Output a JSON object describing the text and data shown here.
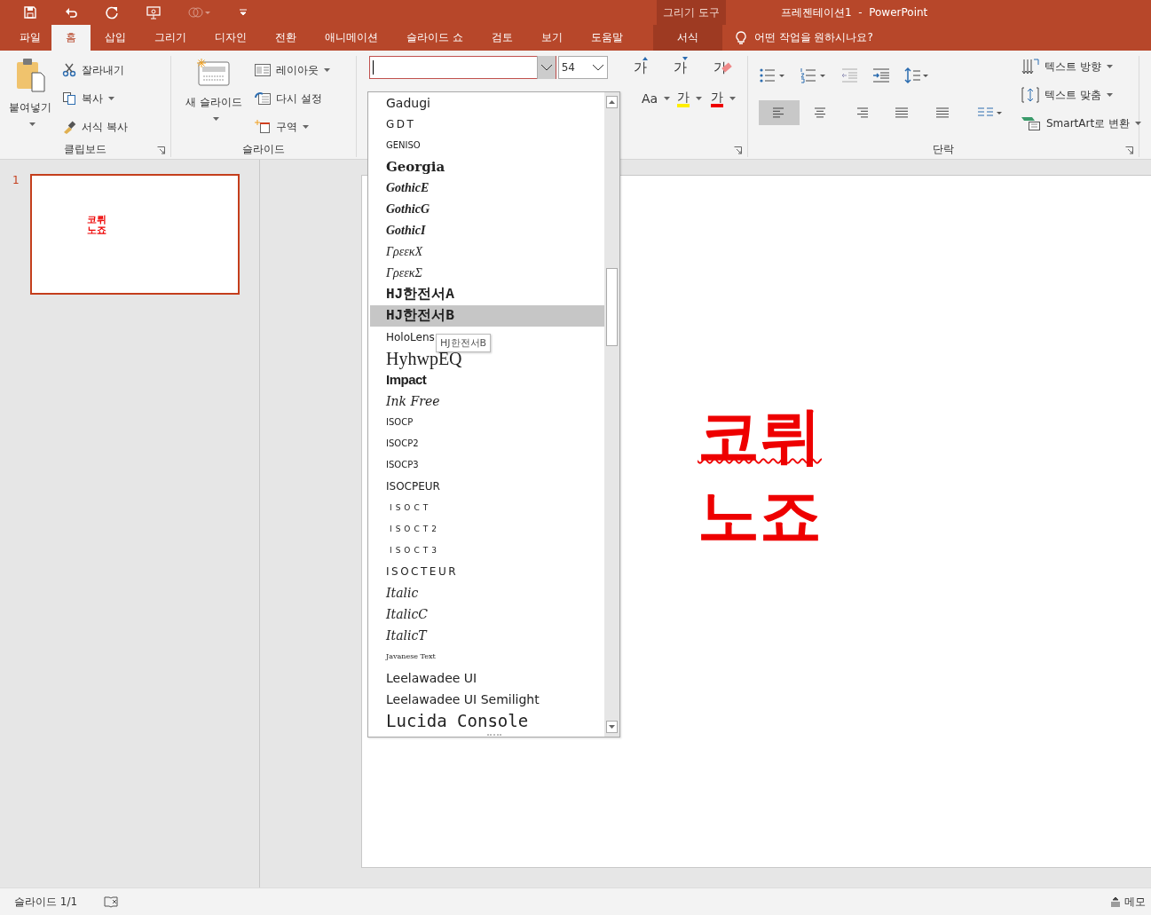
{
  "title_bar": {
    "context_group": "그리기 도구",
    "title": "프레젠테이션1  -  PowerPoint"
  },
  "tabs": [
    {
      "label": "파일",
      "selected": false,
      "kind": "file"
    },
    {
      "label": "홈",
      "selected": true,
      "kind": "normal"
    },
    {
      "label": "삽입",
      "selected": false,
      "kind": "normal"
    },
    {
      "label": "그리기",
      "selected": false,
      "kind": "normal"
    },
    {
      "label": "디자인",
      "selected": false,
      "kind": "normal"
    },
    {
      "label": "전환",
      "selected": false,
      "kind": "normal"
    },
    {
      "label": "애니메이션",
      "selected": false,
      "kind": "normal"
    },
    {
      "label": "슬라이드 쇼",
      "selected": false,
      "kind": "normal"
    },
    {
      "label": "검토",
      "selected": false,
      "kind": "normal"
    },
    {
      "label": "보기",
      "selected": false,
      "kind": "normal"
    },
    {
      "label": "도움말",
      "selected": false,
      "kind": "normal"
    },
    {
      "label": "서식",
      "selected": false,
      "kind": "context"
    }
  ],
  "tell_me": "어떤 작업을 원하시나요?",
  "clipboard": {
    "paste": "붙여넣기",
    "cut": "잘라내기",
    "copy": "복사",
    "format_painter": "서식 복사",
    "label": "클립보드"
  },
  "slides_group": {
    "new_slide": "새 슬라이드",
    "layout": "레이아웃",
    "reset": "다시 설정",
    "section": "구역",
    "label": "슬라이드"
  },
  "font_group": {
    "size": "54",
    "grow": "가",
    "shrink": "가",
    "clear": "가",
    "change_case": "Aa",
    "highlight": "가",
    "font_color": "가"
  },
  "paragraph": {
    "label": "단락",
    "text_direction": "텍스트 방향",
    "align_text": "텍스트 맞춤",
    "smartart": "SmartArt로 변환",
    "alignment": [
      {
        "kind": "left",
        "selected": true
      },
      {
        "kind": "center",
        "selected": false
      },
      {
        "kind": "right",
        "selected": false
      },
      {
        "kind": "justify",
        "selected": false
      },
      {
        "kind": "distributed",
        "selected": false
      }
    ]
  },
  "font_list": {
    "items": [
      {
        "label": "Gadugi",
        "kind": "plain",
        "selected": false
      },
      {
        "label": "GDT",
        "kind": "spaced",
        "selected": false
      },
      {
        "label": "GENISO",
        "kind": "small",
        "selected": false
      },
      {
        "label": "Georgia",
        "kind": "serif-bold",
        "selected": false
      },
      {
        "label": "GothicE",
        "kind": "blackletter",
        "selected": false
      },
      {
        "label": "GothicG",
        "kind": "blackletter",
        "selected": false
      },
      {
        "label": "GothicI",
        "kind": "blackletter",
        "selected": false
      },
      {
        "label": "ΓρεεκΧ",
        "kind": "greek",
        "selected": false
      },
      {
        "label": "ΓρεεκΣ",
        "kind": "greek",
        "selected": false
      },
      {
        "label": "HJ한전서A",
        "kind": "seal",
        "selected": false
      },
      {
        "label": "HJ한전서B",
        "kind": "seal",
        "selected": true
      },
      {
        "label": "HoloLens",
        "kind": "small-plain",
        "selected": false
      },
      {
        "label": "HyhwpEQ",
        "kind": "serif-large",
        "selected": false
      },
      {
        "label": "Impact",
        "kind": "impact",
        "selected": false
      },
      {
        "label": "Ink Free",
        "kind": "script",
        "selected": false
      },
      {
        "label": "ISOCP",
        "kind": "small",
        "selected": false
      },
      {
        "label": "ISOCP2",
        "kind": "small",
        "selected": false
      },
      {
        "label": "ISOCP3",
        "kind": "small",
        "selected": false
      },
      {
        "label": "ISOCPEUR",
        "kind": "medium",
        "selected": false
      },
      {
        "label": "ISOCT",
        "kind": "spaced-small",
        "selected": false
      },
      {
        "label": "ISOCT2",
        "kind": "spaced-small",
        "selected": false
      },
      {
        "label": "ISOCT3",
        "kind": "spaced-small",
        "selected": false
      },
      {
        "label": "ISOCTEUR",
        "kind": "spaced",
        "selected": false
      },
      {
        "label": "Italic",
        "kind": "italic",
        "selected": false
      },
      {
        "label": "ItalicC",
        "kind": "italic",
        "selected": false
      },
      {
        "label": "ItalicT",
        "kind": "italic",
        "selected": false
      },
      {
        "label": "Javanese Text",
        "kind": "tiny",
        "selected": false
      },
      {
        "label": "Leelawadee UI",
        "kind": "plain",
        "selected": false
      },
      {
        "label": "Leelawadee UI Semilight",
        "kind": "plain",
        "selected": false
      },
      {
        "label": "Lucida Console",
        "kind": "mono",
        "selected": false
      }
    ],
    "tooltip": "HJ한전서B"
  },
  "thumbnails": [
    {
      "number": "1",
      "selected": true,
      "lines": [
        "코뤼",
        "노죠"
      ]
    }
  ],
  "slide": {
    "lines": [
      {
        "text": "코뤼",
        "misspelled": true
      },
      {
        "text": "노죠",
        "misspelled": false
      }
    ]
  },
  "status_bar": {
    "slide_info": "슬라이드 1/1",
    "notes": "메모"
  }
}
